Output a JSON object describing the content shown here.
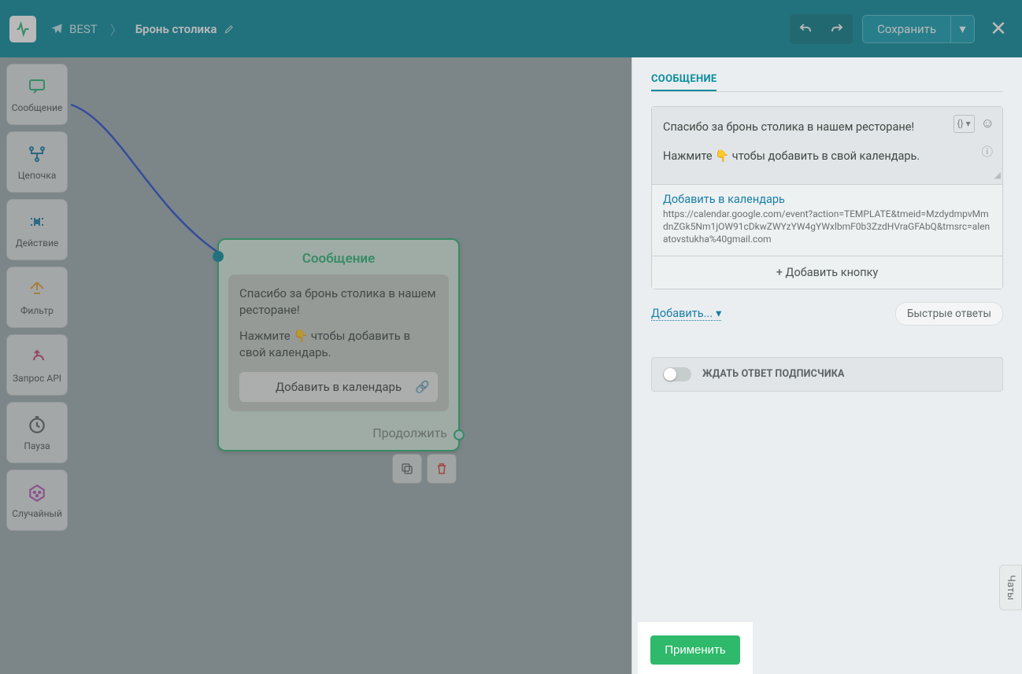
{
  "header": {
    "bot_name": "BEST",
    "flow_name": "Бронь столика",
    "save_label": "Сохранить"
  },
  "toolbox": [
    {
      "label": "Сообщение",
      "icon": "message",
      "color": "#2fb57a"
    },
    {
      "label": "Цепочка",
      "icon": "flow",
      "color": "#1a7fa8"
    },
    {
      "label": "Действие",
      "icon": "action",
      "color": "#1a7fa8"
    },
    {
      "label": "Фильтр",
      "icon": "filter",
      "color": "#e2a23d"
    },
    {
      "label": "Запрос API",
      "icon": "api",
      "color": "#c24a7a"
    },
    {
      "label": "Пауза",
      "icon": "pause",
      "color": "#5c6466"
    },
    {
      "label": "Случайный",
      "icon": "random",
      "color": "#b45bb8"
    }
  ],
  "node": {
    "title": "Сообщение",
    "text_line1": "Спасибо за бронь столика в нашем ресторане!",
    "text_line2": "Нажмите 👇 чтобы добавить в свой календарь.",
    "button_label": "Добавить в календарь",
    "continue_label": "Продолжить"
  },
  "panel": {
    "title": "СООБЩЕНИЕ",
    "editor_line1": "Спасибо за бронь столика в нашем ресторане!",
    "editor_line2": "Нажмите 👇 чтобы добавить в свой календарь.",
    "button_title": "Добавить в календарь",
    "button_url": "https://calendar.google.com/event?action=TEMPLATE&tmeid=MzdydmpvMmdnZGk5Nm1jOW91cDkwZWYzYW4gYWxlbmF0b3ZzdHVraGFAbQ&tmsrc=alenatovstukha%40gmail.com",
    "add_button": "+ Добавить кнопку",
    "add_more": "Добавить...",
    "quick_replies": "Быстрые ответы",
    "wait_label": "ЖДАТЬ ОТВЕТ ПОДПИСЧИКА"
  },
  "apply_label": "Применить",
  "chats_tab": "Чаты"
}
